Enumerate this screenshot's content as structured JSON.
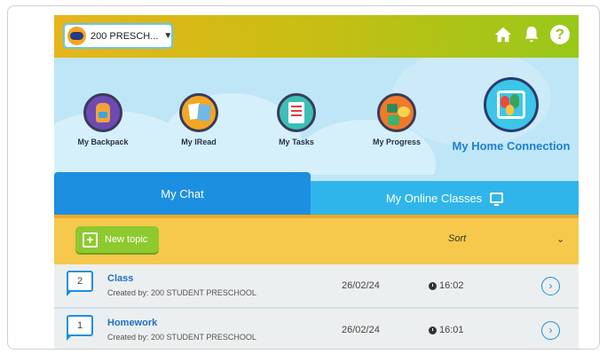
{
  "header": {
    "school_select": "200 PRESCH...",
    "icons": [
      "home-icon",
      "bell-icon",
      "help-icon"
    ]
  },
  "nav": {
    "items": [
      {
        "label": "My Backpack",
        "icon": "backpack-icon"
      },
      {
        "label": "My IRead",
        "icon": "iread-icon"
      },
      {
        "label": "My Tasks",
        "icon": "tasks-icon"
      },
      {
        "label": "My Progress",
        "icon": "progress-icon"
      }
    ],
    "featured": {
      "label": "My Home Connection",
      "icon": "home-connection-icon"
    }
  },
  "tabs": {
    "chat": "My Chat",
    "online_classes": "My Online Classes"
  },
  "toolbar": {
    "new_topic": "New topic",
    "sort": "Sort"
  },
  "topics": [
    {
      "count": "2",
      "title": "Class",
      "created_by": "Created by: 200 STUDENT PRESCHOOL",
      "date": "26/02/24",
      "time": "16:02"
    },
    {
      "count": "1",
      "title": "Homework",
      "created_by": "Created by: 200 STUDENT PRESCHOOL",
      "date": "26/02/24",
      "time": "16:01"
    }
  ],
  "colors": {
    "primary_blue": "#1d8fe0",
    "light_blue": "#30b5ea",
    "toolbar_yellow": "#f6c94c",
    "green": "#8ec92f"
  }
}
